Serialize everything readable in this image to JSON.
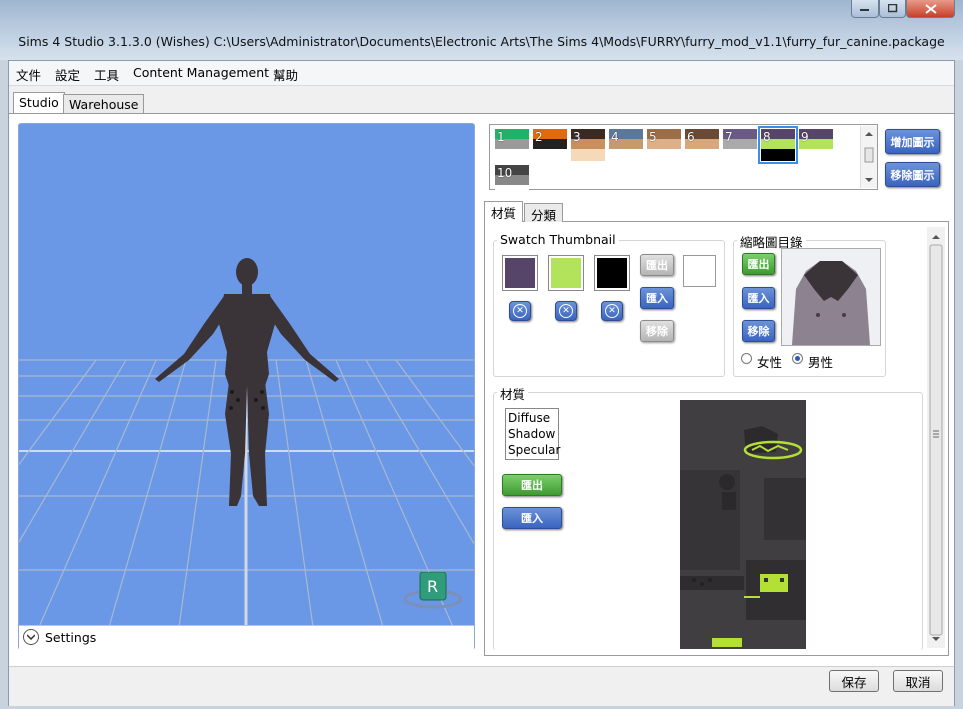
{
  "window": {
    "title": "Sims 4 Studio 3.1.3.0 (Wishes)  C:\\Users\\Administrator\\Documents\\Electronic Arts\\The Sims 4\\Mods\\FURRY\\furry_mod_v1.1\\furry_fur_canine.package",
    "minimize_icon": "minimize-icon",
    "maximize_icon": "maximize-icon",
    "close_icon": "close-icon"
  },
  "menu": [
    "文件",
    "設定",
    "工具",
    "Content Management",
    "幫助"
  ],
  "main_tabs": [
    "Studio",
    "Warehouse"
  ],
  "viewport": {
    "settings_label": "Settings",
    "settings_icon": "chevron-down-icon",
    "reset_badge": "R",
    "colors": {
      "background": "#6a98e7",
      "grid": "#a8b8d0",
      "model": "#3a3438"
    }
  },
  "swatches": [
    {
      "label": "1",
      "colors": [
        "#1fb36a",
        "#9a9a9a",
        "#ffffff"
      ]
    },
    {
      "label": "2",
      "colors": [
        "#e06a10",
        "#222222",
        "#ffffff"
      ]
    },
    {
      "label": "3",
      "colors": [
        "#3a2a22",
        "#c9905e",
        "#f6d9b8"
      ]
    },
    {
      "label": "4",
      "colors": [
        "#5c7898",
        "#c79a6e",
        "#ffffff"
      ]
    },
    {
      "label": "5",
      "colors": [
        "#9b6e48",
        "#ddb08a",
        "#ffffff"
      ]
    },
    {
      "label": "6",
      "colors": [
        "#6a4a34",
        "#d9a77c",
        "#ffffff"
      ]
    },
    {
      "label": "7",
      "colors": [
        "#6a5a84",
        "#aaaaaa",
        "#ffffff"
      ]
    },
    {
      "label": "8",
      "colors": [
        "#574469",
        "#b3e35a",
        "#000000"
      ],
      "selected": true
    },
    {
      "label": "9",
      "colors": [
        "#574469",
        "#b3e35a",
        "#ffffff"
      ]
    },
    {
      "label": "10",
      "colors": [
        "#444444",
        "#888888",
        "#ffffff"
      ]
    }
  ],
  "swatch_buttons": {
    "add": "增加圖示",
    "remove": "移除圖示"
  },
  "sub_tabs": [
    "材質",
    "分類"
  ],
  "swatch_thumbnail": {
    "title": "Swatch Thumbnail",
    "colors": [
      "#574469",
      "#b3e35a",
      "#000000"
    ],
    "export": "匯出",
    "import": "匯入",
    "remove": "移除",
    "remove_icon": "remove-circle-icon"
  },
  "thumbnail_dir": {
    "title": "縮略圖目錄",
    "export": "匯出",
    "import": "匯入",
    "remove": "移除",
    "gender_female": "女性",
    "gender_male": "男性",
    "selected_gender": "男性"
  },
  "material": {
    "title": "材質",
    "list": [
      "Diffuse",
      "Shadow",
      "Specular"
    ],
    "export": "匯出",
    "import": "匯入"
  },
  "footer": {
    "save": "保存",
    "cancel": "取消"
  }
}
